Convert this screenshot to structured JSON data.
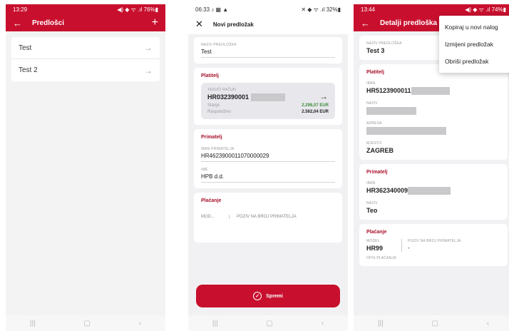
{
  "phone1": {
    "status_time": "13:29",
    "status_right": "◀) ◆ ᯤ .ıl 76%▮",
    "title": "Predlošci",
    "plus": "+",
    "items": [
      {
        "label": "Test"
      },
      {
        "label": "Test 2"
      }
    ]
  },
  "phone2": {
    "status_time": "06:33",
    "status_icons": "♪ ▦ ▲",
    "status_right": "✕ ◆ ᯤ .ıl 32%▮",
    "title": "Novi predložak",
    "naziv_label": "NAZIV PREDLOŠKA",
    "naziv_value": "Test",
    "platitelj_title": "Platitelj",
    "tekuci_label": "TEKUĆI RAČUN",
    "tekuci_value": "HR032390001",
    "stanje_label": "Stanje",
    "stanje_value": "2.298,07 EUR",
    "raspolozivo_label": "Raspoloživo",
    "raspolozivo_value": "2.562,04 EUR",
    "primatelj_title": "Primatelj",
    "iban_label": "IBAN PRIMATELJA",
    "iban_value": "HR4623900011070000029",
    "ime_label": "IME",
    "ime_value": "HPB d.d.",
    "placanje_title": "Plaćanje",
    "model_placeholder": "MOD...",
    "poziv_placeholder": "POZIV NA BROJ PRIMATELJA",
    "save_label": "Spremi"
  },
  "phone3": {
    "status_time": "13:44",
    "status_right": "◀) ◆ ᯤ .ıl 74%▮",
    "title": "Detalji predloška",
    "menu": [
      "Kopiraj u novi nalog",
      "Izmijeni predložak",
      "Obriši predložak"
    ],
    "naziv_label": "NAZIV PREDLOŠKA",
    "naziv_value": "Test 3",
    "platitelj_title": "Platitelj",
    "iban_label": "IBAN",
    "iban_value": "HR5123900011",
    "naziv2_label": "NAZIV",
    "adresa_label": "ADRESA",
    "mjesto_label": "MJESTO",
    "mjesto_value": "ZAGREB",
    "primatelj_title": "Primatelj",
    "p_iban_label": "IBAN",
    "p_iban_value": "HR362340009",
    "p_naziv_label": "NAZIV",
    "p_naziv_value": "Teo",
    "placanje_title": "Plaćanje",
    "model_label": "MODEL",
    "model_value": "HR99",
    "poziv_label": "POZIV NA BROJ PRIMATELJA",
    "poziv_value": "-",
    "opis_label": "OPIS PLAĆANJA"
  },
  "navbar": {
    "recent": "|||",
    "home": "▢",
    "back": "‹"
  }
}
